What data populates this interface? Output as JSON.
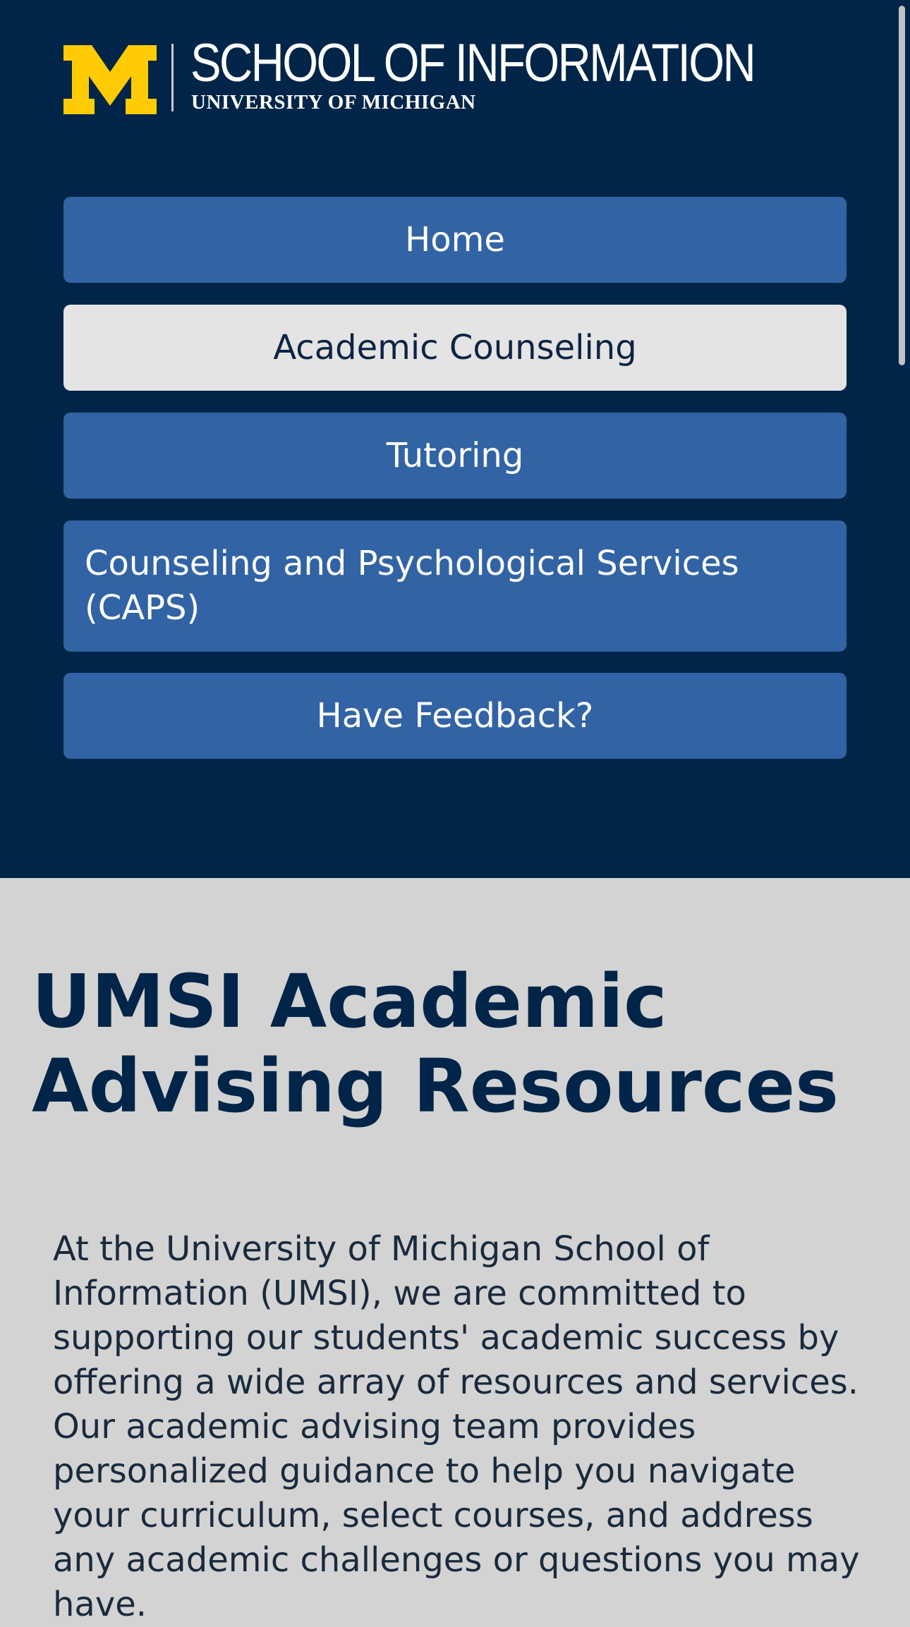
{
  "brand": {
    "logo_letter": "M",
    "title": "SCHOOL OF INFORMATION",
    "subtitle": "UNIVERSITY OF MICHIGAN",
    "maize": "#ffcb05",
    "blue": "#00274c"
  },
  "nav": {
    "items": [
      {
        "label": "Home",
        "active": false
      },
      {
        "label": "Academic Counseling",
        "active": true
      },
      {
        "label": "Tutoring",
        "active": false
      },
      {
        "label": "Counseling and Psychological Services (CAPS)",
        "active": false
      },
      {
        "label": "Have Feedback?",
        "active": false
      }
    ]
  },
  "main": {
    "title": "UMSI Academic Advising Resources",
    "intro": "At the University of Michigan School of Information (UMSI), we are committed to supporting our students' academic success by offering a wide array of resources and services. Our academic advising team provides personalized guidance to help you navigate your curriculum, select courses, and address any academic challenges or questions you may have."
  },
  "colors": {
    "header_bg": "#002548",
    "nav_button": "#3163a5",
    "nav_button_active": "#e4e4e4",
    "page_bg": "#d3d3d3"
  }
}
